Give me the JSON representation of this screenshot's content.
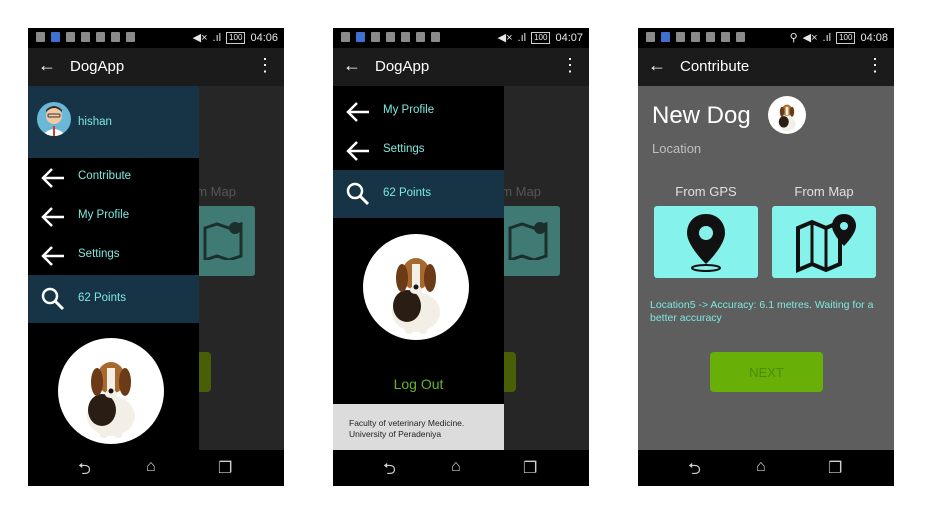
{
  "app": {
    "title": "DogApp"
  },
  "screens": [
    {
      "status": {
        "time": "04:06",
        "battery": "100"
      },
      "appbar_title": "DogApp",
      "user": {
        "name": "hishan"
      },
      "drawer_items": [
        {
          "label": "Contribute",
          "icon": "back-arrow-icon"
        },
        {
          "label": "My Profile",
          "icon": "back-arrow-icon"
        },
        {
          "label": "Settings",
          "icon": "back-arrow-icon"
        },
        {
          "label": "62 Points",
          "icon": "search-icon"
        }
      ],
      "background_label": "om Map"
    },
    {
      "status": {
        "time": "04:07",
        "battery": "100"
      },
      "appbar_title": "DogApp",
      "drawer_items": [
        {
          "label": "My Profile",
          "icon": "back-arrow-icon"
        },
        {
          "label": "Settings",
          "icon": "back-arrow-icon"
        },
        {
          "label": "62 Points",
          "icon": "search-icon"
        }
      ],
      "logout_label": "Log Out",
      "footer": {
        "line1": "Faculty of veterinary Medicine.",
        "line2": "University of Peradeniya"
      },
      "background_label": "om Map"
    },
    {
      "status": {
        "time": "04:08",
        "battery": "100"
      },
      "appbar_title": "Contribute",
      "heading": "New Dog",
      "subheading": "Location",
      "gps_label": "From GPS",
      "map_label": "From Map",
      "info_text": "Location5 -> Accuracy: 6.1 metres. Waiting for a better accuracy",
      "next_label": "NEXT"
    }
  ],
  "colors": {
    "accent": "#7de8e0",
    "highlight": "#163446",
    "tile": "#86f2ec",
    "next": "#68b008"
  }
}
